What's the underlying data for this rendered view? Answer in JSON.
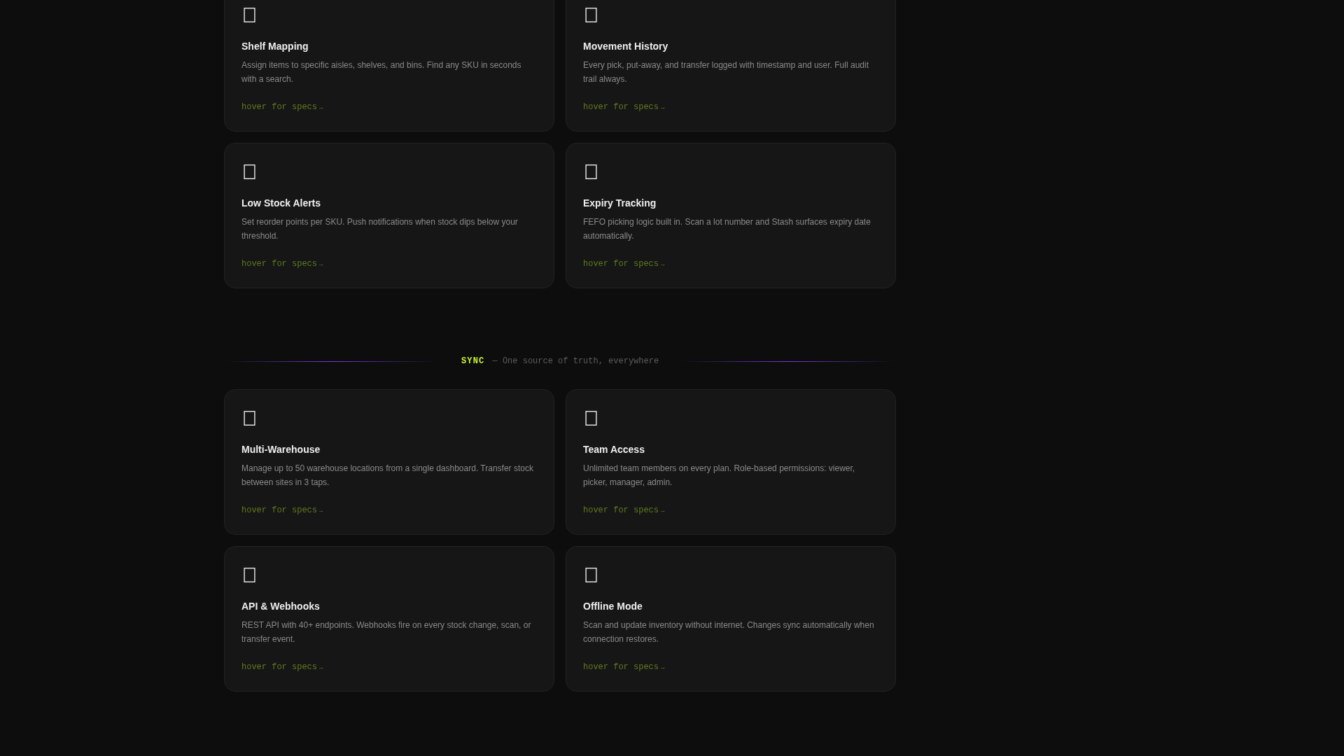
{
  "sections": [
    {
      "cards": [
        {
          "title": "Shelf Mapping",
          "description": "Assign items to specific aisles, shelves, and bins. Find any SKU in seconds with a search.",
          "link": {
            "label": "hover for specs",
            "arrow": "→"
          }
        },
        {
          "title": "Movement History",
          "description": "Every pick, put-away, and transfer logged with timestamp and user. Full audit trail always.",
          "link": {
            "label": "hover for specs",
            "arrow": "→"
          }
        },
        {
          "title": "Low Stock Alerts",
          "description": "Set reorder points per SKU. Push notifications when stock dips below your threshold.",
          "link": {
            "label": "hover for specs",
            "arrow": "→"
          }
        },
        {
          "title": "Expiry Tracking",
          "description": "FEFO picking logic built in. Scan a lot number and Stash surfaces expiry date automatically.",
          "link": {
            "label": "hover for specs",
            "arrow": "→"
          }
        }
      ]
    },
    {
      "header": {
        "tag": "SYNC",
        "subtitle": "— One source of truth, everywhere"
      },
      "cards": [
        {
          "title": "Multi-Warehouse",
          "description": "Manage up to 50 warehouse locations from a single dashboard. Transfer stock between sites in 3 taps.",
          "link": {
            "label": "hover for specs",
            "arrow": "→"
          }
        },
        {
          "title": "Team Access",
          "description": "Unlimited team members on every plan. Role-based permissions: viewer, picker, manager, admin.",
          "link": {
            "label": "hover for specs",
            "arrow": "→"
          }
        },
        {
          "title": "API & Webhooks",
          "description": "REST API with 40+ endpoints. Webhooks fire on every stock change, scan, or transfer event.",
          "link": {
            "label": "hover for specs",
            "arrow": "→"
          }
        },
        {
          "title": "Offline Mode",
          "description": "Scan and update inventory without internet. Changes sync automatically when connection restores.",
          "link": {
            "label": "hover for specs",
            "arrow": "→"
          }
        }
      ]
    }
  ]
}
